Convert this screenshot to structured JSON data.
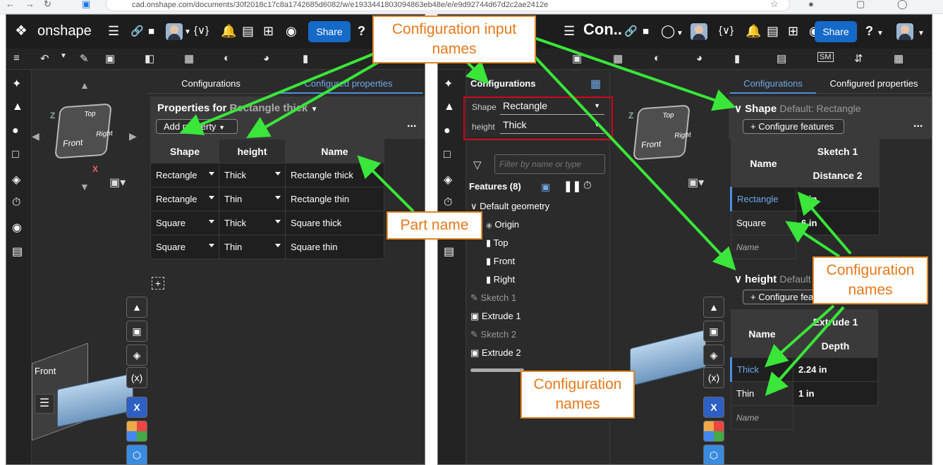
{
  "browser": {
    "url": "cad.onshape.com/documents/30f2018c17c8a1742685d6082/w/e1933441803094863eb48e/e/e9d92744d67d2c2ae2412e"
  },
  "left": {
    "logo": "onshape",
    "share": "Share",
    "help": "?",
    "tabs": [
      "Configurations",
      "Configured properties"
    ],
    "props_title_prefix": "Properties for",
    "props_title_name": "Rectangle thick",
    "add_property": "Add property",
    "more": "...",
    "table": {
      "headers": [
        "Shape",
        "height",
        "Name"
      ],
      "rows": [
        [
          "Rectangle",
          "Thick",
          "Rectangle thick"
        ],
        [
          "Rectangle",
          "Thin",
          "Rectangle thin"
        ],
        [
          "Square",
          "Thick",
          "Square thick"
        ],
        [
          "Square",
          "Thin",
          "Square thin"
        ]
      ]
    },
    "cube": {
      "top": "Top",
      "front": "Front",
      "right": "Right",
      "z": "Z",
      "x": "X"
    },
    "view_label": "Front"
  },
  "right": {
    "title": "Con..",
    "share": "Share",
    "help": "?",
    "config_header": "Configurations",
    "inputs": [
      {
        "label": "Shape",
        "value": "Rectangle"
      },
      {
        "label": "height",
        "value": "Thick"
      }
    ],
    "filter_placeholder": "Filter by name or type",
    "features_label": "Features (8)",
    "tree": [
      "Default geometry",
      "Origin",
      "Top",
      "Front",
      "Right",
      "Sketch 1",
      "Extrude 1",
      "Sketch 2",
      "Extrude 2"
    ],
    "tabs": [
      "Configurations",
      "Configured properties"
    ],
    "shape_section": {
      "title": "Shape",
      "default": "Default: Rectangle",
      "configure": "Configure features",
      "more": "...",
      "col_group": "Sketch 1",
      "name_header": "Name",
      "col": "Distance 2",
      "rows": [
        [
          "Rectangle",
          "3 in"
        ],
        [
          "Square",
          "6 in"
        ]
      ],
      "name_placeholder": "Name"
    },
    "height_section": {
      "title": "height",
      "default": "Default",
      "configure": "Configure features",
      "col_group": "Extrude 1",
      "name_header": "Name",
      "col": "Depth",
      "rows": [
        [
          "Thick",
          "2.24 in"
        ],
        [
          "Thin",
          "1 in"
        ]
      ],
      "name_placeholder": "Name"
    },
    "cube": {
      "top": "Top",
      "front": "Front",
      "right": "Right",
      "z": "Z"
    }
  },
  "callouts": {
    "input_names": "Configuration input names",
    "part_name": "Part name",
    "config_names_right": "Configuration names",
    "config_names_bottom": "Configuration names"
  },
  "colors": {
    "accent": "#1569c7",
    "arrow": "#39e639",
    "callout_border": "#e48a2a",
    "callout_text": "#e8781a",
    "panel": "#2b2b2b",
    "link": "#6fa8e8",
    "highlight": "#d0021b"
  }
}
